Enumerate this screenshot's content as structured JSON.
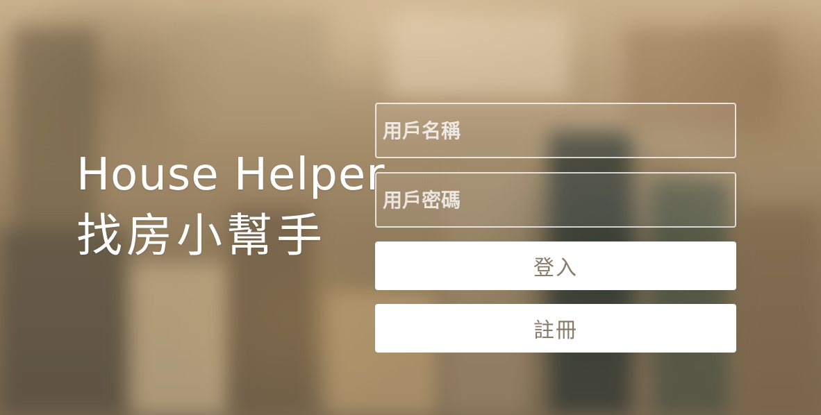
{
  "brand": {
    "title_en": "House Helper",
    "title_zh": "找房小幫手"
  },
  "login_form": {
    "username_placeholder": "用戶名稱",
    "password_placeholder": "用戶密碼",
    "login_label": "登入",
    "register_label": "註冊"
  },
  "colors": {
    "button_bg": "#ffffff",
    "button_text": "#8a7b68",
    "field_border": "#ffffff",
    "title_text": "#ffffff"
  }
}
